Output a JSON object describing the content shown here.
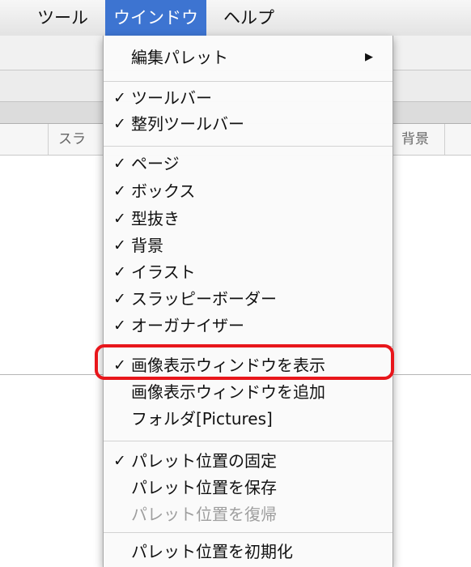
{
  "menubar": {
    "titles": [
      "ツール",
      "ウインドウ",
      "ヘルプ"
    ],
    "active_index": 1
  },
  "background": {
    "tabs": [
      "スラッ",
      "",
      "背景",
      ""
    ]
  },
  "menu": {
    "items": [
      {
        "label": "編集パレット",
        "checked": false,
        "submenu": true,
        "enabled": true
      },
      {
        "label": "ツールバー",
        "checked": true,
        "enabled": true
      },
      {
        "label": "整列ツールバー",
        "checked": true,
        "enabled": true
      },
      {
        "label": "ページ",
        "checked": true,
        "enabled": true
      },
      {
        "label": "ボックス",
        "checked": true,
        "enabled": true
      },
      {
        "label": "型抜き",
        "checked": true,
        "enabled": true
      },
      {
        "label": "背景",
        "checked": true,
        "enabled": true
      },
      {
        "label": "イラスト",
        "checked": true,
        "enabled": true
      },
      {
        "label": "スラッピーボーダー",
        "checked": true,
        "enabled": true
      },
      {
        "label": "オーガナイザー",
        "checked": true,
        "enabled": true
      },
      {
        "label": "画像表示ウィンドウを表示",
        "checked": true,
        "enabled": true,
        "highlighted": true
      },
      {
        "label": "画像表示ウィンドウを追加",
        "checked": false,
        "enabled": true
      },
      {
        "label": "フォルダ[Pictures]",
        "checked": false,
        "enabled": true
      },
      {
        "label": "パレット位置の固定",
        "checked": true,
        "enabled": true
      },
      {
        "label": "パレット位置を保存",
        "checked": false,
        "enabled": true
      },
      {
        "label": "パレット位置を復帰",
        "checked": false,
        "enabled": false
      },
      {
        "label": "パレット位置を初期化",
        "checked": false,
        "enabled": true
      }
    ],
    "check_glyph": "✓",
    "submenu_glyph": "▶"
  },
  "colors": {
    "menu_active": "#3d74d1",
    "highlight_box": "#e8161b",
    "disabled_text": "#9e9e9e"
  }
}
